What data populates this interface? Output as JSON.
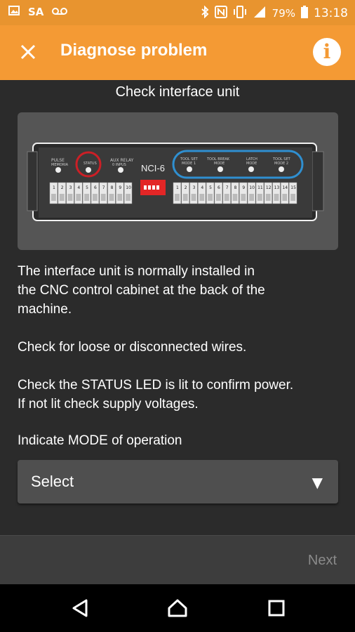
{
  "status_bar": {
    "carrier": "SA",
    "battery": "79%",
    "time": "13:18"
  },
  "app_bar": {
    "title": "Diagnose problem"
  },
  "main": {
    "heading": "Check interface unit",
    "unit": {
      "model": "NCI-6",
      "left_labels": [
        "PULSE",
        "STATUS",
        "AUX RELAY"
      ],
      "left_sublabels": [
        "MEMORIA",
        "",
        "0 INPUS"
      ],
      "right_labels": [
        "TOOL SET",
        "TOOL BREAK",
        "LATCH",
        "TOOL SET"
      ],
      "right_sublabels": [
        "MODE 1",
        "MODE",
        "MODE",
        "MODE 2"
      ],
      "left_numbers": [
        "1",
        "2",
        "3",
        "4",
        "5",
        "6",
        "7",
        "8",
        "9",
        "10"
      ],
      "right_numbers": [
        "1",
        "2",
        "3",
        "4",
        "5",
        "6",
        "7",
        "8",
        "9",
        "10",
        "11",
        "12",
        "13",
        "14",
        "15"
      ]
    },
    "para1_line1": "The interface unit is normally installed in",
    "para1_line2": "the CNC control cabinet at the back of the",
    "para1_line3": "machine.",
    "para2": "Check for loose or disconnected wires.",
    "para3_line1": "Check the STATUS LED is lit to confirm power.",
    "para3_line2": "If not lit check supply voltages.",
    "mode_prompt": "Indicate MODE of operation",
    "select_value": "Select"
  },
  "footer": {
    "next_label": "Next"
  },
  "colors": {
    "accent": "#f49a34",
    "status_ring": "#cc1f26",
    "mode_ring": "#2f8fd0"
  }
}
